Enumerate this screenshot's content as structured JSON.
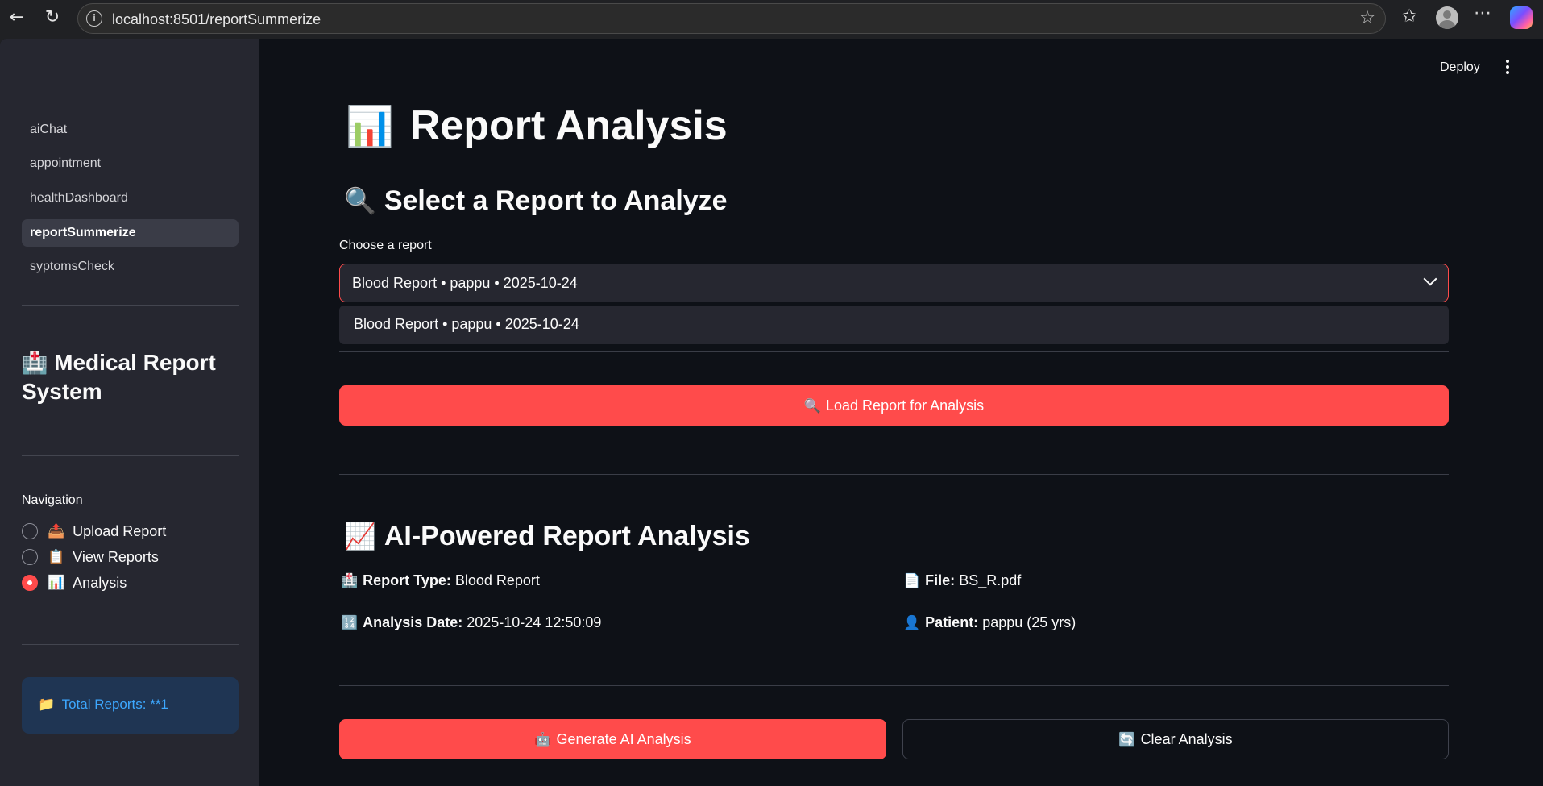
{
  "browser": {
    "url": "localhost:8501/reportSummerize"
  },
  "sidebar": {
    "pages": [
      {
        "label": "aiChat"
      },
      {
        "label": "appointment"
      },
      {
        "label": "healthDashboard"
      },
      {
        "label": "reportSummerize",
        "active": true
      },
      {
        "label": "syptomsCheck"
      }
    ],
    "title_emoji": "🏥",
    "title": "Medical Report System",
    "nav_label": "Navigation",
    "nav_options": [
      {
        "emoji": "📤",
        "label": "Upload Report",
        "selected": false
      },
      {
        "emoji": "📋",
        "label": "View Reports",
        "selected": false
      },
      {
        "emoji": "📊",
        "label": "Analysis",
        "selected": true
      }
    ],
    "info_emoji": "📁",
    "info_text": "Total Reports: **1"
  },
  "header": {
    "deploy_label": "Deploy"
  },
  "main": {
    "title_emoji": "📊",
    "title": "Report Analysis",
    "select_heading_emoji": "🔍",
    "select_heading": "Select a Report to Analyze",
    "select_label": "Choose a report",
    "select_value": "Blood Report • pappu • 2025-10-24",
    "dropdown_options": [
      "Blood Report • pappu • 2025-10-24"
    ],
    "load_button_emoji": "🔍",
    "load_button": "Load Report for Analysis",
    "analysis_heading_emoji": "📈",
    "analysis_heading": "AI-Powered Report Analysis",
    "details": {
      "report_type": {
        "emoji": "🏥",
        "label": "Report Type:",
        "value": "Blood Report"
      },
      "file": {
        "emoji": "📄",
        "label": "File:",
        "value": "BS_R.pdf"
      },
      "analysis_date": {
        "emoji": "🔢",
        "label": "Analysis Date:",
        "value": "2025-10-24 12:50:09"
      },
      "patient": {
        "emoji": "👤",
        "label": "Patient:",
        "value": "pappu (25 yrs)"
      }
    },
    "generate_button_emoji": "🤖",
    "generate_button": "Generate AI Analysis",
    "clear_button_emoji": "🔄",
    "clear_button": "Clear Analysis"
  },
  "colors": {
    "primary": "#ff4b4b",
    "app_bg": "#0e1117",
    "sidebar_bg": "#262730",
    "info_text": "#3da8ff"
  }
}
